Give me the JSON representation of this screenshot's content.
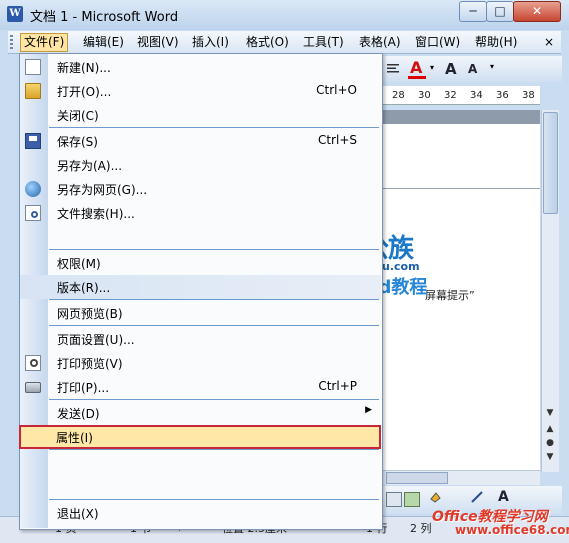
{
  "window": {
    "title": "文档 1 - Microsoft Word",
    "app_icon": "W"
  },
  "caption_buttons": {
    "minimize": "─",
    "maximize": "□",
    "close": "✕"
  },
  "menubar": {
    "items": [
      "文件(F)",
      "编辑(E)",
      "视图(V)",
      "插入(I)",
      "格式(O)",
      "工具(T)",
      "表格(A)",
      "窗口(W)",
      "帮助(H)"
    ],
    "doc_close": "×"
  },
  "toolbar": {
    "font_color": "A",
    "grow_font": "A",
    "shrink_font": "A"
  },
  "ruler": {
    "ticks": [
      "28",
      "30",
      "32",
      "34",
      "36",
      "38"
    ]
  },
  "file_menu": {
    "new": {
      "label": "新建(N)..."
    },
    "open": {
      "label": "打开(O)...",
      "shortcut": "Ctrl+O"
    },
    "close": {
      "label": "关闭(C)"
    },
    "save": {
      "label": "保存(S)",
      "shortcut": "Ctrl+S"
    },
    "save_as": {
      "label": "另存为(A)..."
    },
    "save_as_web": {
      "label": "另存为网页(G)..."
    },
    "file_search": {
      "label": "文件搜索(H)..."
    },
    "permission": {
      "label": "权限(M)"
    },
    "versions": {
      "label": "版本(R)..."
    },
    "web_preview": {
      "label": "网页预览(B)"
    },
    "page_setup": {
      "label": "页面设置(U)..."
    },
    "print_preview": {
      "label": "打印预览(V)"
    },
    "print": {
      "label": "打印(P)...",
      "shortcut": "Ctrl+P"
    },
    "send_to": {
      "label": "发送(D)"
    },
    "properties": {
      "label": "属性(I)"
    },
    "exit": {
      "label": "退出(X)"
    }
  },
  "document": {
    "snippet": "屏幕提示”"
  },
  "statusbar": {
    "page": "1 页",
    "section": "1 节",
    "pages": "1/1",
    "position": "位置 2.5厘米",
    "line": "1 行",
    "column": "2 列"
  },
  "watermark": {
    "logo_main": "办公族",
    "logo_sub": "Officezu.com",
    "logo_tag": "Word教程",
    "corner_logo": "Office教程学习网",
    "corner_url": "www.office68.com"
  }
}
